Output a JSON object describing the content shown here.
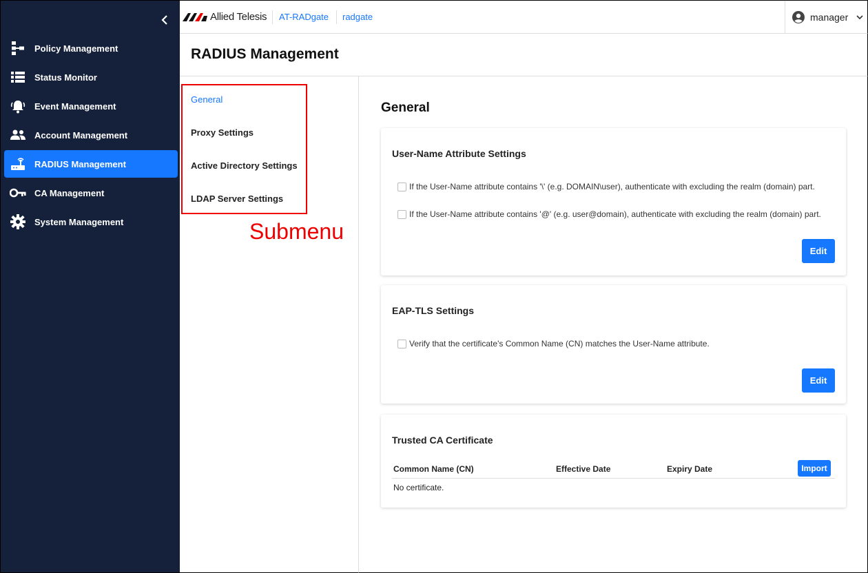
{
  "header": {
    "brand": "Allied Telesis",
    "product": "AT-RADgate",
    "hostname": "radgate",
    "user": "manager"
  },
  "sidebar": {
    "items": [
      {
        "label": "Policy Management",
        "icon": "policy-icon",
        "active": false
      },
      {
        "label": "Status Monitor",
        "icon": "list-icon",
        "active": false
      },
      {
        "label": "Event Management",
        "icon": "bell-icon",
        "active": false
      },
      {
        "label": "Account Management",
        "icon": "people-icon",
        "active": false
      },
      {
        "label": "RADIUS Management",
        "icon": "router-icon",
        "active": true
      },
      {
        "label": "CA Management",
        "icon": "key-icon",
        "active": false
      },
      {
        "label": "System Management",
        "icon": "gear-icon",
        "active": false
      }
    ]
  },
  "page": {
    "title": "RADIUS Management"
  },
  "submenu": {
    "items": [
      {
        "label": "General",
        "active": true
      },
      {
        "label": "Proxy Settings",
        "active": false
      },
      {
        "label": "Active Directory Settings",
        "active": false
      },
      {
        "label": "LDAP Server Settings",
        "active": false
      }
    ],
    "annotation": "Submenu"
  },
  "main": {
    "section_title": "General",
    "username_card": {
      "title": "User-Name Attribute Settings",
      "option1": "If the User-Name attribute contains '\\' (e.g. DOMAIN\\user), authenticate with excluding the realm (domain) part.",
      "option2": "If the User-Name attribute contains '@' (e.g. user@domain), authenticate with excluding the realm (domain) part.",
      "edit_label": "Edit"
    },
    "eaptls_card": {
      "title": "EAP-TLS Settings",
      "option1": "Verify that the certificate's Common Name (CN) matches the User-Name attribute.",
      "edit_label": "Edit"
    },
    "ca_card": {
      "title": "Trusted CA Certificate",
      "columns": [
        "Common Name (CN)",
        "Effective Date",
        "Expiry Date"
      ],
      "import_label": "Import",
      "empty_text": "No certificate."
    }
  },
  "colors": {
    "sidebar_bg": "#15213a",
    "accent": "#1677ff",
    "annotation": "#e00000"
  }
}
